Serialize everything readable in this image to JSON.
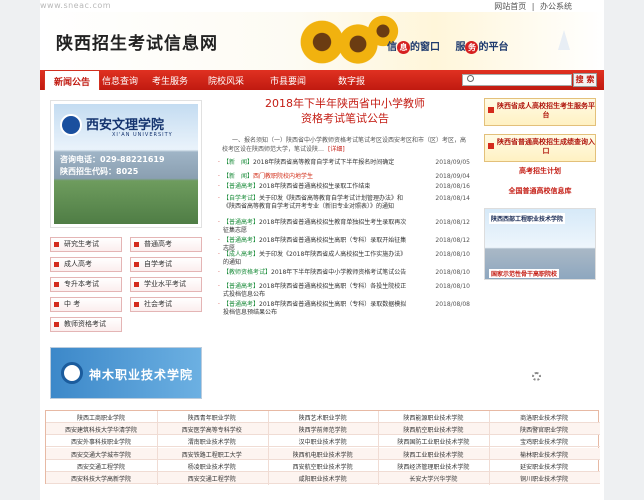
{
  "top": {
    "url": "www.sneac.com",
    "links": [
      "网站首页",
      "|",
      "办公系统"
    ]
  },
  "header": {
    "title": "陕西招生考试信息网",
    "slogan_a": "信",
    "slogan_a_circle": "息",
    "slogan_b": "的窗口",
    "slogan_c": "服",
    "slogan_c_circle": "务",
    "slogan_d": "的平台"
  },
  "nav": {
    "items": [
      "新闻公告",
      "信息查询",
      "考生服务",
      "院校风采",
      "市县要闻",
      "数字报"
    ],
    "search_button": "搜 索"
  },
  "left": {
    "campus": {
      "name": "西安文理学院",
      "sub": "XI'AN UNIVERSITY",
      "tel": "咨询电话：029-88221619",
      "code": "陕西招生代码：8025"
    },
    "buttons": [
      "研究生考试",
      "普通高考",
      "成人高考",
      "自学考试",
      "专升本考试",
      "学业水平考试",
      "中 考",
      "社会考试",
      "教师资格考试"
    ],
    "banner_text": "神木职业技术学院"
  },
  "center": {
    "headline_line1": "2018年下半年陕西省中小学教师",
    "headline_line2": "资格考试笔试公告",
    "summary": "一、报名须知（一）陕西省中小学教师资格考试笔试考区设西安考区和市（区）考区，高校考区设在陕西师范大学，笔试设陕…",
    "summary_link": "[详细]",
    "news": [
      {
        "tag": "【新　闻】",
        "text": "2018年陕西省高等教育自学考试下半年报名时间确定",
        "date": "2018/09/05",
        "hl": false
      },
      {
        "tag": "【新　闻】",
        "text": "西门教职院校内地学生",
        "date": "2018/09/04",
        "hl": true
      },
      {
        "tag": "【普通高考】",
        "text": "2018年陕西省普通高校招生录取工作结束",
        "date": "2018/08/16",
        "hl": false
      },
      {
        "tag": "【自学考试】",
        "text": "关于印发《陕西省高等教育自学考试计划管理办法》和《陕西省高等教育自学考试开考专业（新旧专业对照表）》的通知",
        "date": "2018/08/14",
        "hl": false
      },
      {
        "tag": "【普通高考】",
        "text": "2018年陕西省普通高校招生教育单独招生考生录取再次征集志愿",
        "date": "2018/08/12",
        "hl": false
      },
      {
        "tag": "【普通高考】",
        "text": "2018年陕西省普通高校招生高职（专科）录取开始征集志愿",
        "date": "2018/08/12",
        "hl": false
      },
      {
        "tag": "【成人高考】",
        "text": "关于印发《2018年陕西省成人高校招生工作实施办法》的通知",
        "date": "2018/08/10",
        "hl": false
      },
      {
        "tag": "【教师资格考试】",
        "text": "2018年下半年陕西省中小学教师资格考试笔试公告",
        "date": "2018/08/10",
        "hl": false
      },
      {
        "tag": "【普通高考】",
        "text": "2018年陕西省普通高校招生高职（专科）各投生院校正式投档信息公布",
        "date": "2018/08/10",
        "hl": false
      },
      {
        "tag": "【普通高考】",
        "text": "2018年陕西省普通高校招生高职（专科）录取数据模拟投档信息预结果公布",
        "date": "2018/08/08",
        "hl": false
      }
    ]
  },
  "right": {
    "box1": "陕西省成人高校招生考生服务平台",
    "box2": "陕西省普通高校招生成绩查询入口",
    "link1": "高考招生计划",
    "link2": "全国普通高校信息库",
    "ad_title": "陕西西部工程职业技术学院",
    "ad_caption": "国家示范性骨干高职院校"
  },
  "bottom": {
    "rows": [
      [
        "陕西工商职业学院",
        "陕西青年职业学院",
        "陕西艺术职业学院",
        "陕西能源职业技术学院",
        "商洛职业技术学院"
      ],
      [
        "西安建筑科技大学华清学院",
        "西安医学高等专科学校",
        "陕西学前师范学院",
        "陕西航空职业技术学院",
        "陕西警官职业学院"
      ],
      [
        "西安外事科技职业学院",
        "渭南职业技术学院",
        "汉中职业技术学院",
        "陕西国防工业职业技术学院",
        "宝鸡职业技术学院"
      ],
      [
        "西安交通大学城市学院",
        "西安铁路工程职工大学",
        "陕西机电职业技术学院",
        "陕西工业职业技术学院",
        "榆林职业技术学院"
      ],
      [
        "西安交通工程学院",
        "杨凌职业技术学院",
        "西安航空职业技术学院",
        "陕西经济管理职业技术学院",
        "延安职业技术学院"
      ],
      [
        "西安科技大学高新学院",
        "西安交通工程学院",
        "咸阳职业技术学院",
        "长安大学兴华学院",
        "铜川职业技术学院"
      ]
    ]
  }
}
